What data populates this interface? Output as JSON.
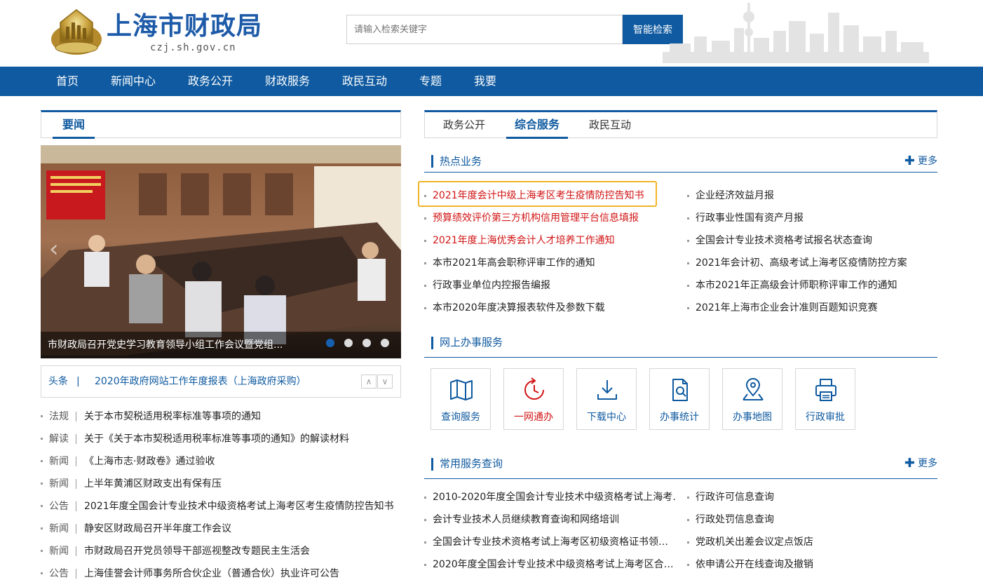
{
  "site": {
    "title": "上海市财政局",
    "domain": "czj.sh.gov.cn"
  },
  "search": {
    "placeholder": "请输入检索关键字",
    "button": "智能检索"
  },
  "nav": [
    "首页",
    "新闻中心",
    "政务公开",
    "财政服务",
    "政民互动",
    "专题",
    "我要"
  ],
  "left": {
    "tab": "要闻",
    "slider_caption": "市财政局召开党史学习教育领导小组工作会议暨党组...",
    "slide_count": 4,
    "active_slide": 1,
    "headline_label": "头条",
    "headline_sep": "|",
    "headline_text": "2020年政府网站工作年度报表（上海政府采购）",
    "news": [
      {
        "cat": "法规",
        "title": "关于本市契税适用税率标准等事项的通知"
      },
      {
        "cat": "解读",
        "title": "关于《关于本市契税适用税率标准等事项的通知》的解读材料"
      },
      {
        "cat": "新闻",
        "title": "《上海市志·财政卷》通过验收"
      },
      {
        "cat": "新闻",
        "title": "上半年黄浦区财政支出有保有压"
      },
      {
        "cat": "公告",
        "title": "2021年度全国会计专业技术中级资格考试上海考区考生疫情防控告知书"
      },
      {
        "cat": "新闻",
        "title": "静安区财政局召开半年度工作会议"
      },
      {
        "cat": "新闻",
        "title": "市财政局召开党员领导干部巡视整改专题民主生活会"
      },
      {
        "cat": "公告",
        "title": "上海佳誉会计师事务所合伙企业（普通合伙）执业许可公告"
      }
    ]
  },
  "right": {
    "tabs": [
      "政务公开",
      "综合服务",
      "政民互动"
    ],
    "active_tab": 1,
    "hot": {
      "title": "热点业务",
      "more": "更多",
      "left_items": [
        {
          "text": "2021年度会计中级上海考区考生疫情防控告知书",
          "red": true
        },
        {
          "text": "预算绩效评价第三方机构信用管理平台信息填报",
          "red": true
        },
        {
          "text": "2021年度上海优秀会计人才培养工作通知",
          "red": true
        },
        {
          "text": "本市2021年高会职称评审工作的通知",
          "red": false
        },
        {
          "text": "行政事业单位内控报告编报",
          "red": false
        },
        {
          "text": "本市2020年度决算报表软件及参数下载",
          "red": false
        }
      ],
      "right_items": [
        "企业经济效益月报",
        "行政事业性国有资产月报",
        "全国会计专业技术资格考试报名状态查询",
        "2021年会计初、高级考试上海考区疫情防控方案",
        "本市2021年正高级会计师职称评审工作的通知",
        "2021年上海市企业会计准则百题知识竞赛"
      ]
    },
    "online": {
      "title": "网上办事服务",
      "services": [
        {
          "label": "查询服务",
          "icon": "map-icon",
          "red": false
        },
        {
          "label": "一网通办",
          "icon": "refresh-clock-icon",
          "red": true
        },
        {
          "label": "下载中心",
          "icon": "download-icon",
          "red": false
        },
        {
          "label": "办事统计",
          "icon": "document-search-icon",
          "red": false
        },
        {
          "label": "办事地图",
          "icon": "location-pin-icon",
          "red": false
        },
        {
          "label": "行政审批",
          "icon": "printer-icon",
          "red": false
        }
      ]
    },
    "common": {
      "title": "常用服务查询",
      "more": "更多",
      "left_items": [
        "2010-2020年度全国会计专业技术中级资格考试上海考…",
        "会计专业技术人员继续教育查询和网络培训",
        "全国会计专业技术资格考试上海考区初级资格证书领…",
        "2020年度全国会计专业技术中级资格考试上海考区合…"
      ],
      "right_items": [
        "行政许可信息查询",
        "行政处罚信息查询",
        "党政机关出差会议定点饭店",
        "依申请公开在线查询及撤销"
      ]
    }
  },
  "colors": {
    "primary": "#0f5aa0",
    "red": "#d21414",
    "highlight": "#f0b428"
  }
}
